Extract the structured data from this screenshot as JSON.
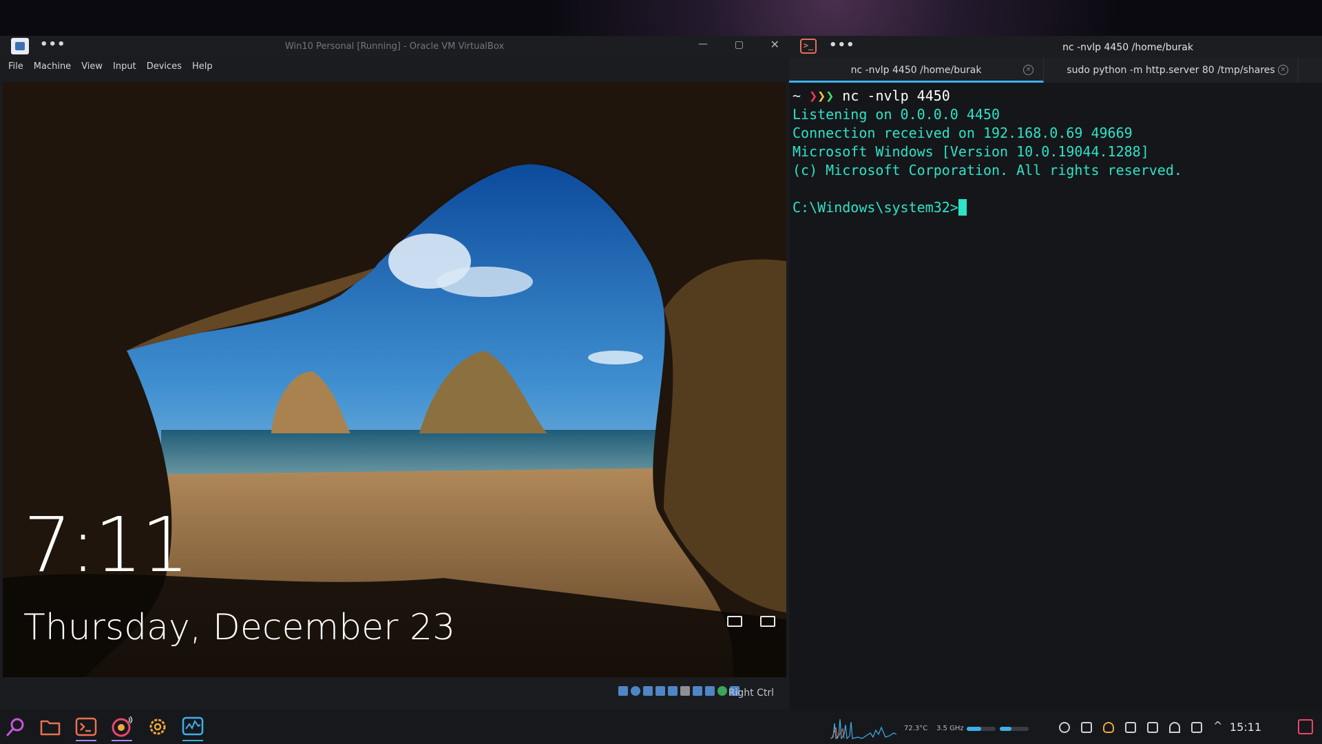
{
  "vbox": {
    "title": "Win10 Personal [Running] - Oracle VM VirtualBox",
    "menu": [
      "File",
      "Machine",
      "View",
      "Input",
      "Devices",
      "Help"
    ],
    "status_label": "Right Ctrl"
  },
  "lockscreen": {
    "time": "7:11",
    "date": "Thursday, December 23"
  },
  "terminal": {
    "title": "nc -nvlp 4450 /home/burak",
    "tabs": [
      {
        "label": "nc -nvlp 4450 /home/burak",
        "active": true
      },
      {
        "label": "sudo python -m http.server 80 /tmp/shares",
        "active": false
      }
    ],
    "prompt": "~",
    "prompt_chevrons": "❯❯❯",
    "command": "nc -nvlp 4450",
    "output": [
      "Listening on 0.0.0.0 4450",
      "Connection received on 192.168.0.69 49669",
      "Microsoft Windows [Version 10.0.19044.1288]",
      "(c) Microsoft Corporation. All rights reserved.",
      "",
      "C:\\Windows\\system32>"
    ]
  },
  "taskbar": {
    "apps": [
      "search-icon",
      "files-icon",
      "terminal-icon",
      "media-icon",
      "settings-icon",
      "system-monitor-icon"
    ],
    "temp": "72.3°C",
    "cpu_freq": "3.5 GHz",
    "clock": "15:11",
    "colors": {
      "accent": "#3db0ea",
      "terminal_output": "#2ee3c7"
    }
  }
}
